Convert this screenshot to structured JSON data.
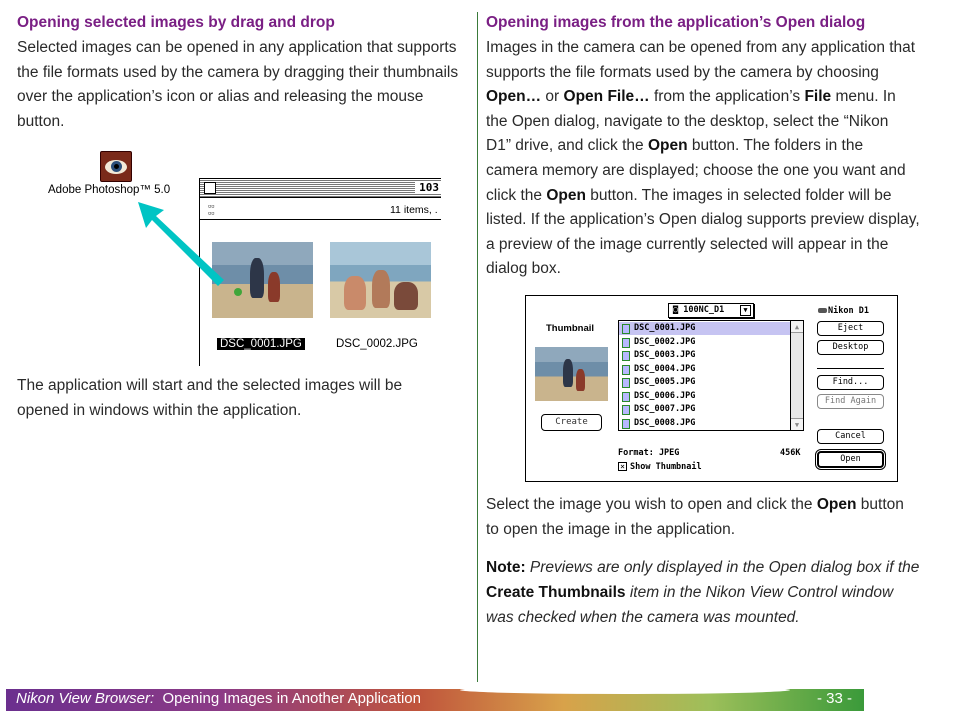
{
  "left": {
    "heading": "Opening selected images by drag and drop",
    "intro_lines": [
      "Selected images can be opened in any application that supports",
      "the file formats used by the camera by dragging their thumbnails",
      "over the application’s icon or alias and releasing the mouse",
      "button."
    ],
    "app_label": "Adobe Photoshop™ 5.0",
    "window_name": "103",
    "window_items": "11 items, .",
    "thumb_1_caption": "DSC_0001.JPG",
    "thumb_2_caption": "DSC_0002.JPG",
    "result_lines": [
      "The application will start and the selected images will be",
      "opened in windows within the application."
    ]
  },
  "right": {
    "heading": "Opening images from the application’s Open dialog",
    "body_lines": [
      "Images in the camera can be opened from any application that",
      "supports the file formats used by the camera by choosing",
      "<b>Open…</b> or <b>Open File…</b> from the application’s <b>File</b> menu.  In",
      "the Open dialog, navigate to the desktop, select the “Nikon",
      "D1” drive, and click the <b>Open</b> button.  The folders in the",
      "camera memory are displayed; choose the one you want and",
      "click the <b>Open</b> button.  The images in selected folder will be",
      "listed.  If the application’s Open dialog supports preview display,",
      "a preview of the image currently selected will appear in the",
      "dialog box."
    ],
    "dialog": {
      "thumbnail_label": "Thumbnail",
      "folder": "100NC_D1",
      "drive": "Nikon D1",
      "files": [
        "DSC_0001.JPG",
        "DSC_0002.JPG",
        "DSC_0003.JPG",
        "DSC_0004.JPG",
        "DSC_0005.JPG",
        "DSC_0006.JPG",
        "DSC_0007.JPG",
        "DSC_0008.JPG"
      ],
      "selected_index": 0,
      "buttons": {
        "eject": "Eject",
        "desktop": "Desktop",
        "find": "Find...",
        "find_again": "Find Again",
        "cancel": "Cancel",
        "open": "Open",
        "create": "Create"
      },
      "format": "Format: JPEG",
      "size": "456K",
      "show_thumbnail": "Show Thumbnail",
      "show_thumbnail_checked": true
    },
    "select_lines": [
      "Select the image you wish to open and click the <b>Open</b> button",
      "to open the image in the application."
    ],
    "note_lines": [
      "<b>Note:</b>  <i>Previews are only displayed in the Open dialog box if the</i>",
      "<b>Create Thumbnails</b> <i>item in the Nikon View Control window</i>",
      "<i>was checked when the camera was mounted.</i>"
    ]
  },
  "footer": {
    "title_italic": "Nikon View Browser:",
    "title_rest": "Opening Images in Another Application",
    "page": "- 33 -"
  },
  "colors": {
    "heading": "#7a1f84",
    "divider": "#3a7a3a",
    "arrow": "#00c4c4",
    "footer_start": "#6b2f8e",
    "footer_end": "#3a9a3a"
  }
}
